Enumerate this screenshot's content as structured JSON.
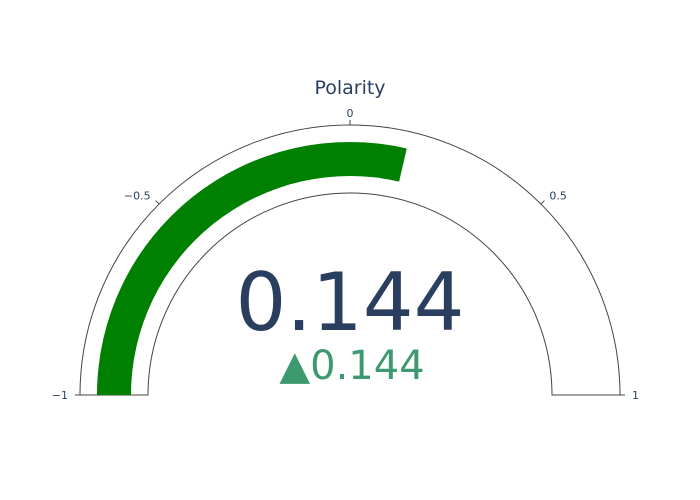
{
  "chart_data": {
    "type": "gauge",
    "title": "Polarity",
    "value": 0.144,
    "value_label": "0.144",
    "delta": {
      "value": 0.144,
      "label": "0.144",
      "direction": "up",
      "symbol": "▲",
      "color": "#3d9970"
    },
    "range": [
      -1,
      1
    ],
    "tick_values": [
      -1,
      -0.5,
      0,
      0.5,
      1
    ],
    "tick_labels": [
      "−1",
      "−0.5",
      "0",
      "0.5",
      "1"
    ],
    "bar_color": "#008000",
    "text_color": "#2a3f5f"
  }
}
